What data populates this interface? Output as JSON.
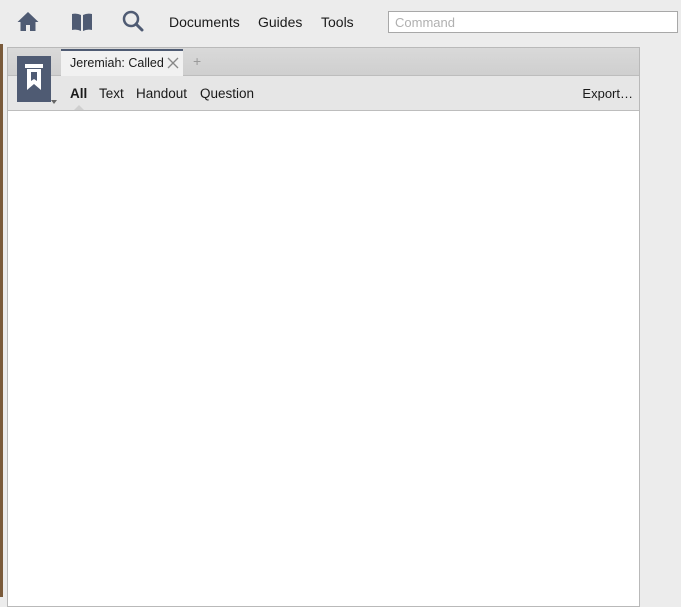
{
  "toolbar": {
    "icons": [
      "home-icon",
      "library-icon",
      "search-icon"
    ],
    "menu": {
      "documents": "Documents",
      "guides": "Guides",
      "tools": "Tools"
    },
    "command_placeholder": "Command"
  },
  "panel": {
    "resource_icon": "resource-panel-icon",
    "tabs": [
      {
        "label": "Jeremiah: Called",
        "active": true
      }
    ],
    "add_tab_label": "+",
    "filters": [
      {
        "label": "All",
        "active": true
      },
      {
        "label": "Text",
        "active": false
      },
      {
        "label": "Handout",
        "active": false
      },
      {
        "label": "Question",
        "active": false
      }
    ],
    "export_label": "Export…"
  },
  "colors": {
    "accent": "#4f5b73",
    "background": "#ececec",
    "panel_header": "#e6e6e6",
    "content": "#ffffff"
  }
}
